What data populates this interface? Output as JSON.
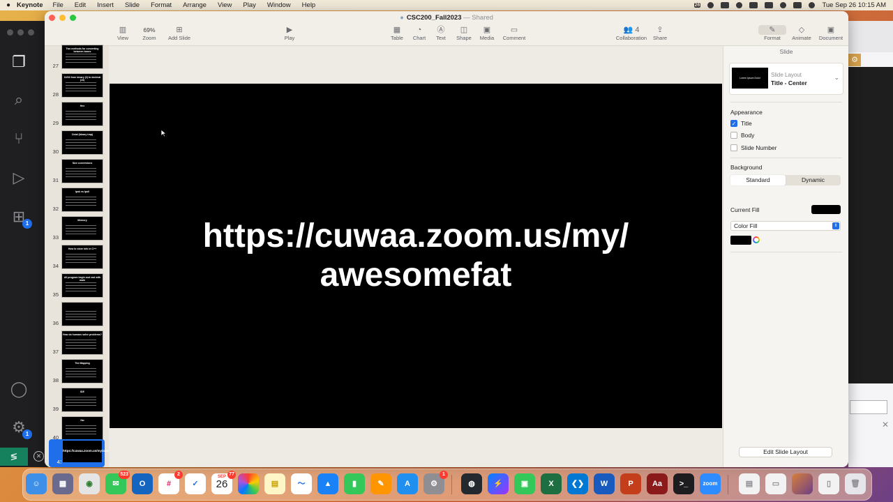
{
  "menubar": {
    "app_name": "Keynote",
    "items": [
      "File",
      "Edit",
      "Insert",
      "Slide",
      "Format",
      "Arrange",
      "View",
      "Play",
      "Window",
      "Help"
    ],
    "status_badge": "26",
    "datetime": "Tue Sep 26  10:15 AM"
  },
  "window": {
    "doc_name": "CSC200_Fall2023",
    "doc_status": "— Shared"
  },
  "toolbar": {
    "view": "View",
    "zoom_value": "69%",
    "zoom": "Zoom",
    "add_slide": "Add Slide",
    "play": "Play",
    "table": "Table",
    "chart": "Chart",
    "text": "Text",
    "shape": "Shape",
    "media": "Media",
    "comment": "Comment",
    "collaboration_count": "4",
    "collaboration": "Collaboration",
    "share": "Share",
    "format": "Format",
    "animate": "Animate",
    "document": "Document"
  },
  "slides": [
    {
      "num": "27",
      "title": "Two methods for converting between bases"
    },
    {
      "num": "28",
      "title": "10/16 from binary (2) to decimal (10)"
    },
    {
      "num": "29",
      "title": "Hex"
    },
    {
      "num": "30",
      "title": "Octal (binary trap)"
    },
    {
      "num": "31",
      "title": "Size conversions"
    },
    {
      "num": "32",
      "title": "Ipok vs Ipoll"
    },
    {
      "num": "33",
      "title": "Memory"
    },
    {
      "num": "34",
      "title": "How to store info in C++"
    },
    {
      "num": "35",
      "title": "All program begin and end with main"
    },
    {
      "num": "36",
      "title": ""
    },
    {
      "num": "37",
      "title": "How do humans solve problems?"
    },
    {
      "num": "38",
      "title": "The Mapping"
    },
    {
      "num": "39",
      "title": "IDE"
    },
    {
      "num": "40",
      "title": "Hw"
    },
    {
      "num": "41",
      "title": "https://cuwaa.zoom.us/my/awesomefat"
    }
  ],
  "current_slide": {
    "title": "https://cuwaa.zoom.us/my/\nawesomefat"
  },
  "inspector": {
    "tab": "Slide",
    "layout_label": "Slide Layout",
    "layout_value": "Title - Center",
    "layout_thumb_text": "Lorem Ipsum Dolor",
    "appearance": "Appearance",
    "title": "Title",
    "body": "Body",
    "slide_number": "Slide Number",
    "background": "Background",
    "standard": "Standard",
    "dynamic": "Dynamic",
    "current_fill": "Current Fill",
    "fill_type": "Color Fill",
    "edit_layout": "Edit Slide Layout"
  },
  "vscode": {
    "extensions_badge": "1",
    "settings_badge": "1"
  },
  "dock": {
    "messages_badge": "523",
    "slack_badge": "2",
    "calendar_month": "SEP",
    "calendar_badge": "77",
    "calendar_day": "26",
    "settings_badge": "1",
    "zoom_label": "zoom"
  },
  "colors": {
    "accent": "#1f6feb",
    "slide_bg": "#000000",
    "slide_text": "#ffffff"
  }
}
